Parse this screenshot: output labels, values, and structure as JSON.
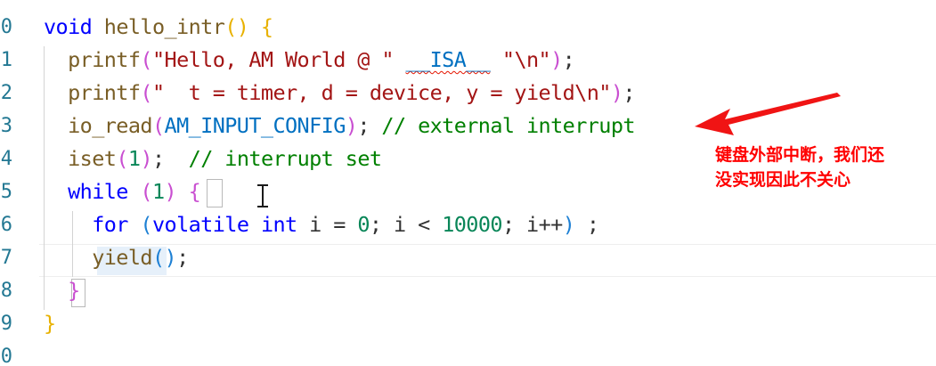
{
  "editor": {
    "line_numbers": [
      "0",
      "1",
      "2",
      "3",
      "4",
      "5",
      "6",
      "7",
      "8",
      "9",
      "0"
    ],
    "lines": [
      [
        {
          "t": "void",
          "c": "kw"
        },
        {
          "t": " ",
          "c": "plain"
        },
        {
          "t": "hello_intr",
          "c": "fn"
        },
        {
          "t": "()",
          "c": "br1"
        },
        {
          "t": " ",
          "c": "plain"
        },
        {
          "t": "{",
          "c": "br1"
        }
      ],
      [
        {
          "t": "  ",
          "c": "plain"
        },
        {
          "t": "printf",
          "c": "fn"
        },
        {
          "t": "(",
          "c": "br2"
        },
        {
          "t": "\"Hello, AM World @ \" ",
          "c": "str"
        },
        {
          "t": "__ISA__",
          "c": "mac squig"
        },
        {
          "t": " ",
          "c": "str"
        },
        {
          "t": "\"\\n\"",
          "c": "str"
        },
        {
          "t": ")",
          "c": "br2"
        },
        {
          "t": ";",
          "c": "plain"
        }
      ],
      [
        {
          "t": "  ",
          "c": "plain"
        },
        {
          "t": "printf",
          "c": "fn"
        },
        {
          "t": "(",
          "c": "br2"
        },
        {
          "t": "\"  t = timer, d = device, y = yield\\n\"",
          "c": "str"
        },
        {
          "t": ")",
          "c": "br2"
        },
        {
          "t": ";",
          "c": "plain"
        }
      ],
      [
        {
          "t": "  ",
          "c": "plain"
        },
        {
          "t": "io_read",
          "c": "fn"
        },
        {
          "t": "(",
          "c": "br2"
        },
        {
          "t": "AM_INPUT_CONFIG",
          "c": "mac"
        },
        {
          "t": ")",
          "c": "br2"
        },
        {
          "t": "; ",
          "c": "plain"
        },
        {
          "t": "// external interrupt",
          "c": "cmt"
        }
      ],
      [
        {
          "t": "  ",
          "c": "plain"
        },
        {
          "t": "iset",
          "c": "fn"
        },
        {
          "t": "(",
          "c": "br2"
        },
        {
          "t": "1",
          "c": "num"
        },
        {
          "t": ")",
          "c": "br2"
        },
        {
          "t": ";  ",
          "c": "plain"
        },
        {
          "t": "// interrupt set",
          "c": "cmt"
        }
      ],
      [
        {
          "t": "  ",
          "c": "plain"
        },
        {
          "t": "while",
          "c": "kw"
        },
        {
          "t": " ",
          "c": "plain"
        },
        {
          "t": "(",
          "c": "br2"
        },
        {
          "t": "1",
          "c": "num"
        },
        {
          "t": ")",
          "c": "br2"
        },
        {
          "t": " ",
          "c": "plain"
        },
        {
          "t": "{",
          "c": "br2"
        }
      ],
      [
        {
          "t": "    ",
          "c": "plain"
        },
        {
          "t": "for",
          "c": "kw"
        },
        {
          "t": " ",
          "c": "plain"
        },
        {
          "t": "(",
          "c": "br3"
        },
        {
          "t": "volatile",
          "c": "kw"
        },
        {
          "t": " ",
          "c": "plain"
        },
        {
          "t": "int",
          "c": "kw"
        },
        {
          "t": " i = ",
          "c": "plain"
        },
        {
          "t": "0",
          "c": "num"
        },
        {
          "t": "; i < ",
          "c": "plain"
        },
        {
          "t": "10000",
          "c": "num"
        },
        {
          "t": "; i++",
          "c": "plain"
        },
        {
          "t": ")",
          "c": "br3"
        },
        {
          "t": " ;",
          "c": "plain"
        }
      ],
      [
        {
          "t": "    ",
          "c": "plain"
        },
        {
          "t": "yield",
          "c": "fn"
        },
        {
          "t": "()",
          "c": "br3"
        },
        {
          "t": ";",
          "c": "plain"
        }
      ],
      [
        {
          "t": "  ",
          "c": "plain"
        },
        {
          "t": "}",
          "c": "br2"
        }
      ],
      [
        {
          "t": "}",
          "c": "br1"
        }
      ],
      []
    ]
  },
  "annotation": {
    "text_line1": "键盘外部中断，我们还",
    "text_line2": "没实现因此不关心",
    "color": "#ff0000"
  },
  "colors": {
    "keyword": "#0000ff",
    "function": "#795e26",
    "string": "#a31515",
    "number": "#098658",
    "comment": "#008000",
    "macro": "#0070c1",
    "line_number": "#237893"
  }
}
